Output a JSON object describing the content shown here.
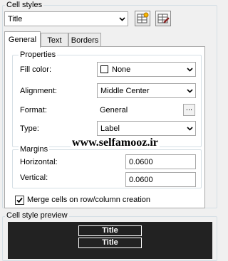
{
  "cell_styles": {
    "legend": "Cell styles",
    "selected_style": "Title"
  },
  "tabs": [
    {
      "label": "General"
    },
    {
      "label": "Text"
    },
    {
      "label": "Borders"
    }
  ],
  "properties": {
    "legend": "Properties",
    "fill_color": {
      "label": "Fill color:",
      "value": "None"
    },
    "alignment": {
      "label": "Alignment:",
      "value": "Middle Center"
    },
    "format": {
      "label": "Format:",
      "value": "General",
      "button": "..."
    },
    "type": {
      "label": "Type:",
      "value": "Label"
    }
  },
  "watermark": "www.selfamooz.ir",
  "margins": {
    "legend": "Margins",
    "horizontal": {
      "label": "Horizontal:",
      "value": "0.0600"
    },
    "vertical": {
      "label": "Vertical:",
      "value": "0.0600"
    }
  },
  "merge_cells": {
    "label": "Merge cells on row/column creation",
    "checked": true
  },
  "preview": {
    "legend": "Cell style preview",
    "cells": [
      "Title",
      "Title"
    ]
  }
}
